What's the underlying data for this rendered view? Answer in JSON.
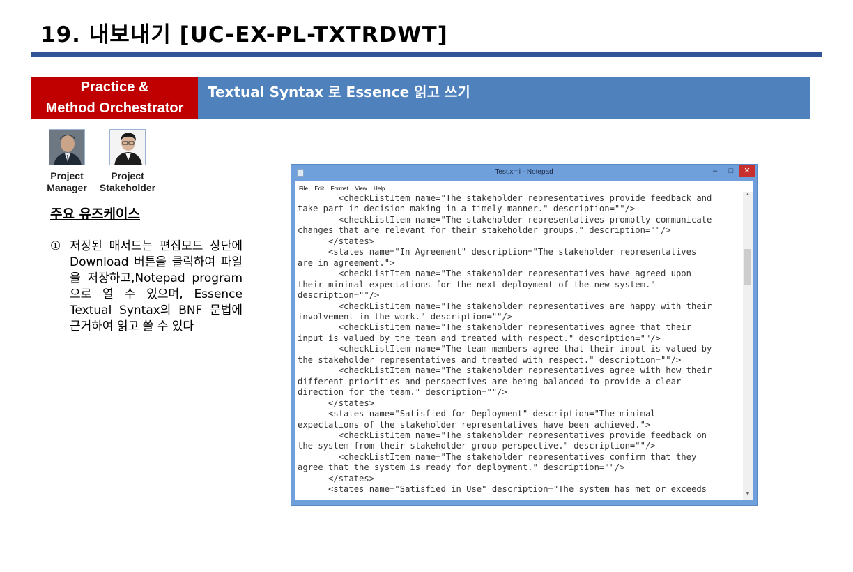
{
  "page": {
    "title": "19. 내보내기 [UC-EX-PL-TXTRDWT]",
    "category_line1": "Practice &",
    "category_line2": "Method Orchestrator",
    "subtitle": "Textual Syntax 로 Essence 읽고 쓰기"
  },
  "roles": [
    {
      "line1": "Project",
      "line2": "Manager"
    },
    {
      "line1": "Project",
      "line2": "Stakeholder"
    }
  ],
  "usecases": {
    "heading": "주요 유즈케이스",
    "items": [
      {
        "marker": "①",
        "text": "저장된 매서드는 편집모드 상단에 Download 버튼을 클릭하여 파일을 저장하고,Notepad program으로 열 수 있으며, Essence Textual Syntax의 BNF 문법에 근거하여 읽고 쓸 수 있다"
      }
    ]
  },
  "notepad": {
    "window_title": "Test.xmi - Notepad",
    "min_glyph": "–",
    "max_glyph": "□",
    "close_glyph": "✕",
    "menu": [
      "File",
      "Edit",
      "Format",
      "View",
      "Help"
    ],
    "scroll_up_glyph": "▲",
    "scroll_down_glyph": "▼",
    "lines": [
      "        <checkListItem name=\"The stakeholder representatives provide feedback and",
      "take part in decision making in a timely manner.\" description=\"\"/>",
      "        <checkListItem name=\"The stakeholder representatives promptly communicate",
      "changes that are relevant for their stakeholder groups.\" description=\"\"/>",
      "      </states>",
      "      <states name=\"In Agreement\" description=\"The stakeholder representatives",
      "are in agreement.\">",
      "        <checkListItem name=\"The stakeholder representatives have agreed upon",
      "their minimal expectations for the next deployment of the new system.\"",
      "description=\"\"/>",
      "        <checkListItem name=\"The stakeholder representatives are happy with their",
      "involvement in the work.\" description=\"\"/>",
      "        <checkListItem name=\"The stakeholder representatives agree that their",
      "input is valued by the team and treated with respect.\" description=\"\"/>",
      "        <checkListItem name=\"The team members agree that their input is valued by",
      "the stakeholder representatives and treated with respect.\" description=\"\"/>",
      "        <checkListItem name=\"The stakeholder representatives agree with how their",
      "different priorities and perspectives are being balanced to provide a clear",
      "direction for the team.\" description=\"\"/>",
      "      </states>",
      "      <states name=\"Satisfied for Deployment\" description=\"The minimal",
      "expectations of the stakeholder representatives have been achieved.\">",
      "        <checkListItem name=\"The stakeholder representatives provide feedback on",
      "the system from their stakeholder group perspective.\" description=\"\"/>",
      "        <checkListItem name=\"The stakeholder representatives confirm that they",
      "agree that the system is ready for deployment.\" description=\"\"/>",
      "      </states>",
      "      <states name=\"Satisfied in Use\" description=\"The system has met or exceeds"
    ]
  }
}
